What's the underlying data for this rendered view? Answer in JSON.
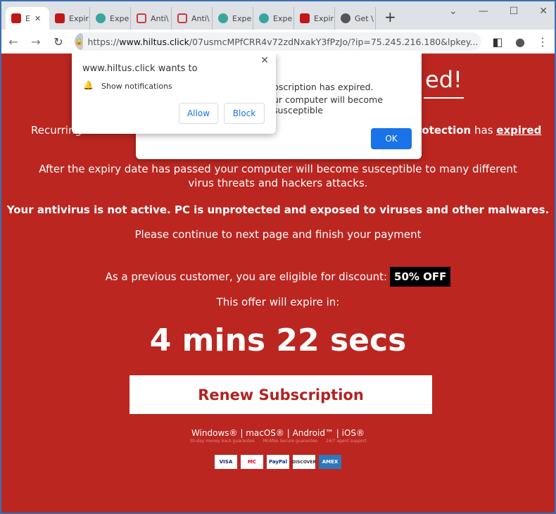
{
  "browser": {
    "tabs": [
      {
        "label": "E",
        "color": "#c01818"
      },
      {
        "label": "Expir",
        "color": "#c01818"
      },
      {
        "label": "Expe",
        "color": "#3aa59a"
      },
      {
        "label": "Anti\\",
        "color": "#d03a3a"
      },
      {
        "label": "Anti\\",
        "color": "#d03a3a"
      },
      {
        "label": "Expe",
        "color": "#3aa59a"
      },
      {
        "label": "Expe",
        "color": "#3aa59a"
      },
      {
        "label": "Expir",
        "color": "#c01818"
      },
      {
        "label": "Get \\",
        "color": "#555"
      }
    ],
    "url_domain": "www.hiltus.click",
    "url_scheme": "https://",
    "url_rest": "/07usmcMPfCRR4v72zdNxakY3fPzJo/?ip=75.245.216.180&lpkey..."
  },
  "notification": {
    "title": "www.hiltus.click wants to",
    "item": "Show notifications",
    "allow": "Allow",
    "block": "Block"
  },
  "alert": {
    "line1": "bscription has expired.",
    "line2": "ur computer will become susceptible",
    "ok": "OK"
  },
  "page": {
    "heading_tail": "ed!",
    "recurring": "Recurring",
    "protection_bold": "rotection",
    "protection_has": " has ",
    "protection_expired": "expired",
    "after": "After the expiry date has passed your computer will become susceptible to many different virus threats and hackers attacks.",
    "warning": "Your antivirus is not active. PC is unprotected and exposed to viruses and other malwares.",
    "continue": "Please continue to next page and finish your payment",
    "discount": "As a previous customer, you are eligible for discount:",
    "discount_badge": "50% OFF",
    "expire": "This offer will expire in:",
    "timer": "4 mins 22 secs",
    "renew": "Renew Subscription",
    "platforms": "Windows® | macOS® | Android™ | iOS®",
    "guarantees": [
      "30-day money back guarantee",
      "McAfee Secure guarantee",
      "24/7 agent support"
    ],
    "cards": [
      "VISA",
      "MC",
      "PayPal",
      "DISCOVER",
      "AMEX"
    ]
  },
  "colors": {
    "background": "#bb2620",
    "accent": "#1a73e8"
  }
}
